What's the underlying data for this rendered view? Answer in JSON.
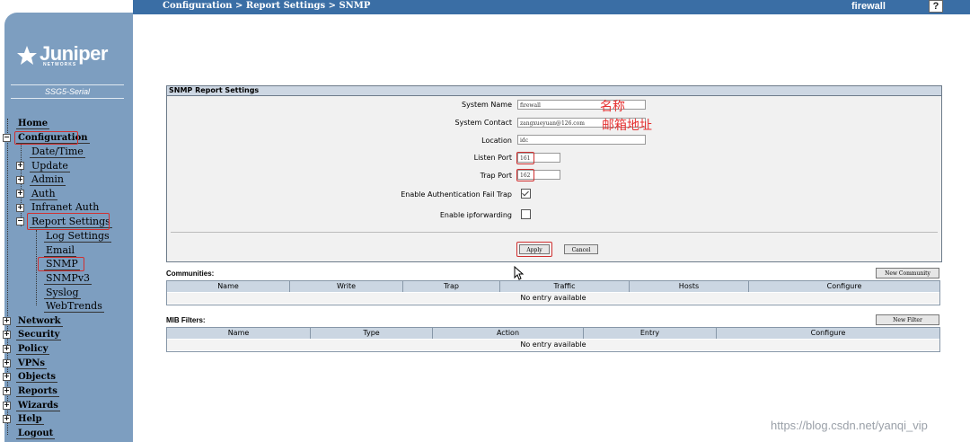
{
  "header": {
    "breadcrumb": "Configuration > Report Settings > SNMP",
    "hostname": "firewall",
    "help_label": "?"
  },
  "sidebar": {
    "logo_text": "Juniper",
    "logo_sub": "NETWORKS",
    "device": "SSG5-Serial",
    "items": [
      {
        "label": "Home"
      },
      {
        "label": "Configuration"
      },
      {
        "label": "Date/Time"
      },
      {
        "label": "Update"
      },
      {
        "label": "Admin"
      },
      {
        "label": "Auth"
      },
      {
        "label": "Infranet Auth"
      },
      {
        "label": "Report Settings"
      },
      {
        "label": "Log Settings"
      },
      {
        "label": "Email"
      },
      {
        "label": "SNMP"
      },
      {
        "label": "SNMPv3"
      },
      {
        "label": "Syslog"
      },
      {
        "label": "WebTrends"
      },
      {
        "label": "Network"
      },
      {
        "label": "Security"
      },
      {
        "label": "Policy"
      },
      {
        "label": "VPNs"
      },
      {
        "label": "Objects"
      },
      {
        "label": "Reports"
      },
      {
        "label": "Wizards"
      },
      {
        "label": "Help"
      },
      {
        "label": "Logout"
      }
    ]
  },
  "form": {
    "title": "SNMP Report Settings",
    "system_name_label": "System Name",
    "system_name_value": "firewall",
    "system_contact_label": "System Contact",
    "system_contact_value": "zangxueyuan@126.com",
    "location_label": "Location",
    "location_value": "idc",
    "listen_port_label": "Listen Port",
    "listen_port_value": "161",
    "trap_port_label": "Trap Port",
    "trap_port_value": "162",
    "auth_fail_trap_label": "Enable Authentication Fail Trap",
    "auth_fail_trap_checked": true,
    "ipforwarding_label": "Enable ipforwarding",
    "ipforwarding_checked": false,
    "apply_label": "Apply",
    "cancel_label": "Cancel"
  },
  "annotations": {
    "name_note": "名称",
    "email_note": "邮箱地址"
  },
  "communities": {
    "title": "Communities:",
    "new_button": "New Community",
    "columns": [
      "Name",
      "Write",
      "Trap",
      "Traffic",
      "Hosts",
      "Configure"
    ],
    "empty_text": "No entry available"
  },
  "mib_filters": {
    "title": "MIB Filters:",
    "new_button": "New Filter",
    "columns": [
      "Name",
      "Type",
      "Action",
      "Entry",
      "Configure"
    ],
    "empty_text": "No entry available"
  },
  "watermark": "https://blog.csdn.net/yanqi_vip"
}
